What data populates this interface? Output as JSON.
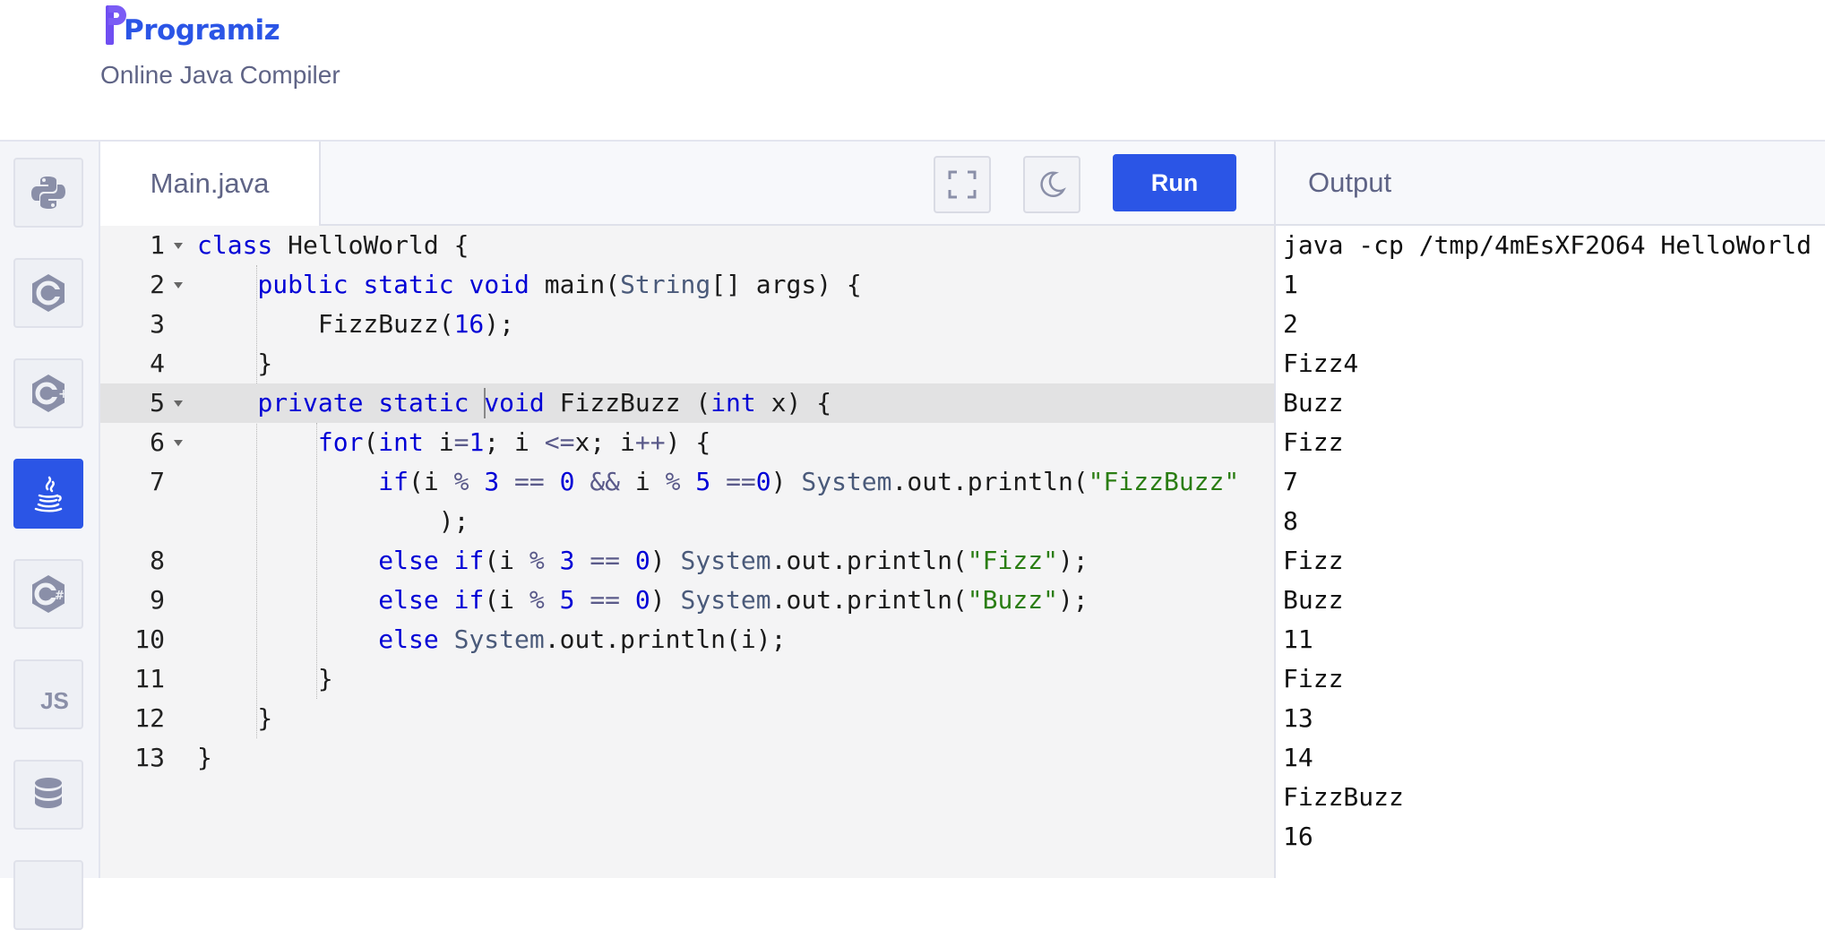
{
  "brand": {
    "name": "Programiz",
    "subtitle": "Online Java Compiler",
    "accent": "#2b55e6"
  },
  "sidebar": {
    "items": [
      {
        "name": "python",
        "icon": "python-icon",
        "active": false
      },
      {
        "name": "c",
        "icon": "c-icon",
        "active": false
      },
      {
        "name": "cpp",
        "icon": "cpp-icon",
        "active": false
      },
      {
        "name": "java",
        "icon": "java-icon",
        "active": true
      },
      {
        "name": "csharp",
        "icon": "csharp-icon",
        "active": false
      },
      {
        "name": "javascript",
        "icon": "js-icon",
        "label": "JS",
        "active": false
      },
      {
        "name": "sql",
        "icon": "database-icon",
        "active": false
      }
    ]
  },
  "editor": {
    "filename": "Main.java",
    "run_label": "Run",
    "fullscreen_icon": "fullscreen-icon",
    "theme_icon": "moon-icon",
    "active_line": 5,
    "lines": [
      {
        "n": "1",
        "fold": true
      },
      {
        "n": "2",
        "fold": true
      },
      {
        "n": "3",
        "fold": false
      },
      {
        "n": "4",
        "fold": false
      },
      {
        "n": "5",
        "fold": true
      },
      {
        "n": "6",
        "fold": true
      },
      {
        "n": "7",
        "fold": false
      },
      {
        "n": "",
        "fold": false
      },
      {
        "n": "8",
        "fold": false
      },
      {
        "n": "9",
        "fold": false
      },
      {
        "n": "10",
        "fold": false
      },
      {
        "n": "11",
        "fold": false
      },
      {
        "n": "12",
        "fold": false
      },
      {
        "n": "13",
        "fold": false
      }
    ],
    "code": [
      "class HelloWorld {",
      "    public static void main(String[] args) {",
      "        FizzBuzz(16);",
      "    }",
      "    private static void FizzBuzz (int x) {",
      "        for(int i=1; i <=x; i++) {",
      "            if(i % 3 == 0 && i % 5 ==0) System.out.println(\"FizzBuzz\"",
      "                );",
      "            else if(i % 3 == 0) System.out.println(\"Fizz\");",
      "            else if(i % 5 == 0) System.out.println(\"Buzz\");",
      "            else System.out.println(i);",
      "        }",
      "    }",
      "}"
    ]
  },
  "output": {
    "title": "Output",
    "lines": [
      "java -cp /tmp/4mEsXF2O64 HelloWorld",
      "1",
      "2",
      "Fizz4",
      "Buzz",
      "Fizz",
      "7",
      "8",
      "Fizz",
      "Buzz",
      "11",
      "Fizz",
      "13",
      "14",
      "FizzBuzz",
      "16"
    ]
  }
}
